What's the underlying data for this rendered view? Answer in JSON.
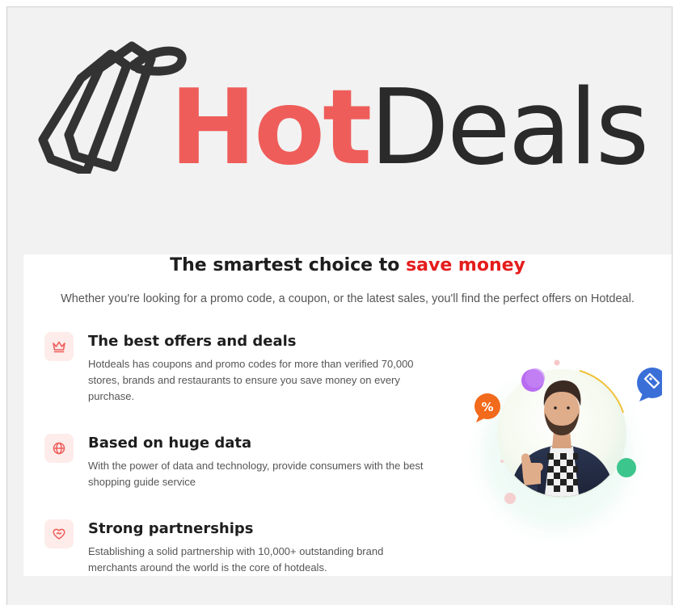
{
  "logo": {
    "hot": "Hot",
    "deals": "Deals"
  },
  "headline": {
    "prefix": "The smartest choice to ",
    "accent": "save money",
    "accent_color": "#e51c1c"
  },
  "subline": "Whether you're looking for a promo code, a coupon, or the latest sales, you'll find the perfect offers on Hotdeal.",
  "features": [
    {
      "icon": "crown-icon",
      "title": "The best offers and deals",
      "description": "Hotdeals has coupons and promo codes for more than verified 70,000 stores, brands and restaurants to ensure you save money on every purchase."
    },
    {
      "icon": "globe-icon",
      "title": "Based on huge data",
      "description": "With the power of data and technology, provide consumers with the best shopping guide service"
    },
    {
      "icon": "heart-handshake-icon",
      "title": "Strong partnerships",
      "description": "Establishing a solid partnership with 10,000+ outstanding brand merchants around the world is the core of hotdeals."
    }
  ],
  "hero": {
    "percent_badge": "%"
  },
  "colors": {
    "brand_red": "#ee5d5a",
    "dark": "#2a2a2a",
    "icon_bg": "#fdecea",
    "percent_badge": "#f26a1b",
    "tag_badge": "#3a6fd8"
  }
}
